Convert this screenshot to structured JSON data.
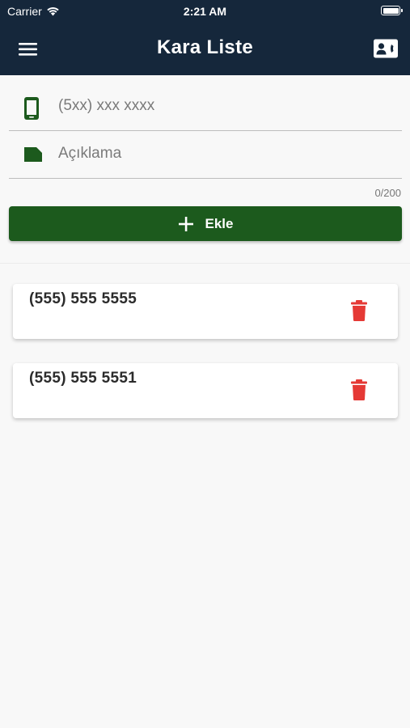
{
  "status_bar": {
    "carrier": "Carrier",
    "time": "2:21 AM"
  },
  "header": {
    "title": "Kara Liste",
    "background": "#15273b"
  },
  "form": {
    "phone_placeholder": "(5xx) xxx xxxx",
    "phone_value": "",
    "description_placeholder": "Açıklama",
    "description_value": "",
    "counter": "0/200",
    "add_button_label": "Ekle",
    "accent": "#1c5a1d"
  },
  "list": {
    "items": [
      {
        "phone": "(555) 555 5555"
      },
      {
        "phone": "(555) 555 5551"
      }
    ],
    "delete_color": "#e53935"
  },
  "icons": {
    "menu": "hamburger-menu-icon",
    "contact": "contact-card-icon",
    "phone": "smartphone-icon",
    "description": "label-tag-icon",
    "add": "plus-icon",
    "delete": "trash-icon",
    "wifi": "wifi-icon",
    "battery": "battery-icon"
  }
}
